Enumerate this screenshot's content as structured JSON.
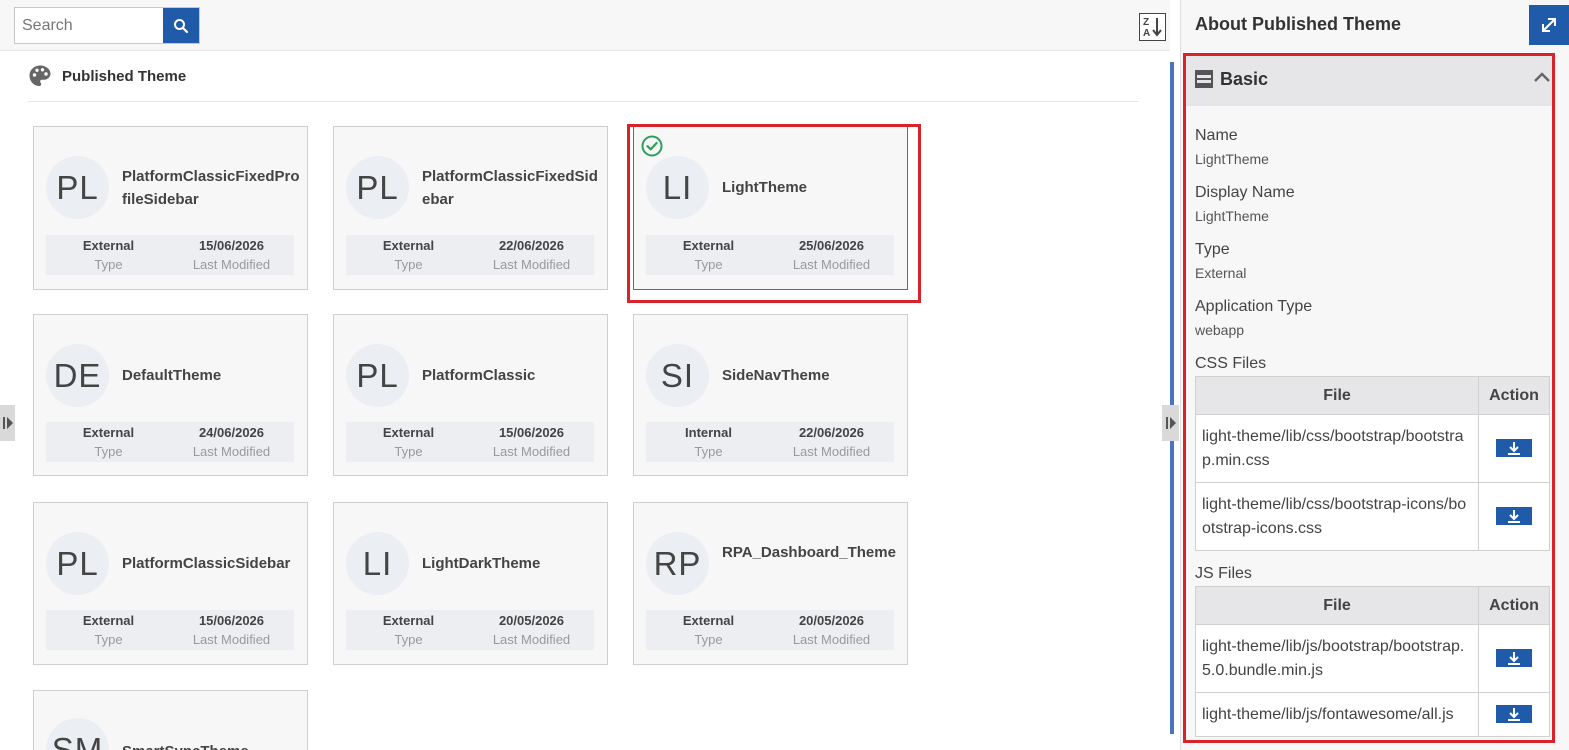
{
  "search": {
    "placeholder": "Search"
  },
  "section": {
    "title": "Published Theme"
  },
  "cards": [
    {
      "initials": "PL",
      "name": "PlatformClassicFixedProfileSidebar",
      "type": "External",
      "date": "15/06/2026",
      "type_label": "Type",
      "date_label": "Last Modified",
      "selected": false
    },
    {
      "initials": "PL",
      "name": "PlatformClassicFixedSidebar",
      "type": "External",
      "date": "22/06/2026",
      "type_label": "Type",
      "date_label": "Last Modified",
      "selected": false
    },
    {
      "initials": "LI",
      "name": "LightTheme",
      "type": "External",
      "date": "25/06/2026",
      "type_label": "Type",
      "date_label": "Last Modified",
      "selected": true
    },
    {
      "initials": "DE",
      "name": "DefaultTheme",
      "type": "External",
      "date": "24/06/2026",
      "type_label": "Type",
      "date_label": "Last Modified",
      "selected": false
    },
    {
      "initials": "PL",
      "name": "PlatformClassic",
      "type": "External",
      "date": "15/06/2026",
      "type_label": "Type",
      "date_label": "Last Modified",
      "selected": false
    },
    {
      "initials": "SI",
      "name": "SideNavTheme",
      "type": "Internal",
      "date": "22/06/2026",
      "type_label": "Type",
      "date_label": "Last Modified",
      "selected": false
    },
    {
      "initials": "PL",
      "name": "PlatformClassicSidebar",
      "type": "External",
      "date": "15/06/2026",
      "type_label": "Type",
      "date_label": "Last Modified",
      "selected": false
    },
    {
      "initials": "LI",
      "name": "LightDarkTheme",
      "type": "External",
      "date": "20/05/2026",
      "type_label": "Type",
      "date_label": "Last Modified",
      "selected": false
    },
    {
      "initials": "RP",
      "name": "RPA_Dashboard_Theme",
      "type": "External",
      "date": "20/05/2026",
      "type_label": "Type",
      "date_label": "Last Modified",
      "selected": false
    },
    {
      "initials": "SM",
      "name": "SmartSyncTheme",
      "type": "",
      "date": "",
      "type_label": "",
      "date_label": "",
      "selected": false
    }
  ],
  "panel": {
    "title": "About Published Theme",
    "section_label": "Basic",
    "fields": {
      "name_label": "Name",
      "name_value": "LightTheme",
      "display_label": "Display Name",
      "display_value": "LightTheme",
      "type_label": "Type",
      "type_value": "External",
      "apptype_label": "Application Type",
      "apptype_value": "webapp"
    },
    "css_title": "CSS Files",
    "js_title": "JS Files",
    "col_file": "File",
    "col_action": "Action",
    "css_files": [
      "light-theme/lib/css/bootstrap/bootstrap.min.css",
      "light-theme/lib/css/bootstrap-icons/bootstrap-icons.css"
    ],
    "js_files": [
      "light-theme/lib/js/bootstrap/bootstrap.5.0.bundle.min.js",
      "light-theme/lib/js/fontawesome/all.js"
    ]
  },
  "colors": {
    "accent": "#1f5ba8",
    "highlight": "#d8232a",
    "check": "#2e9e5b"
  }
}
